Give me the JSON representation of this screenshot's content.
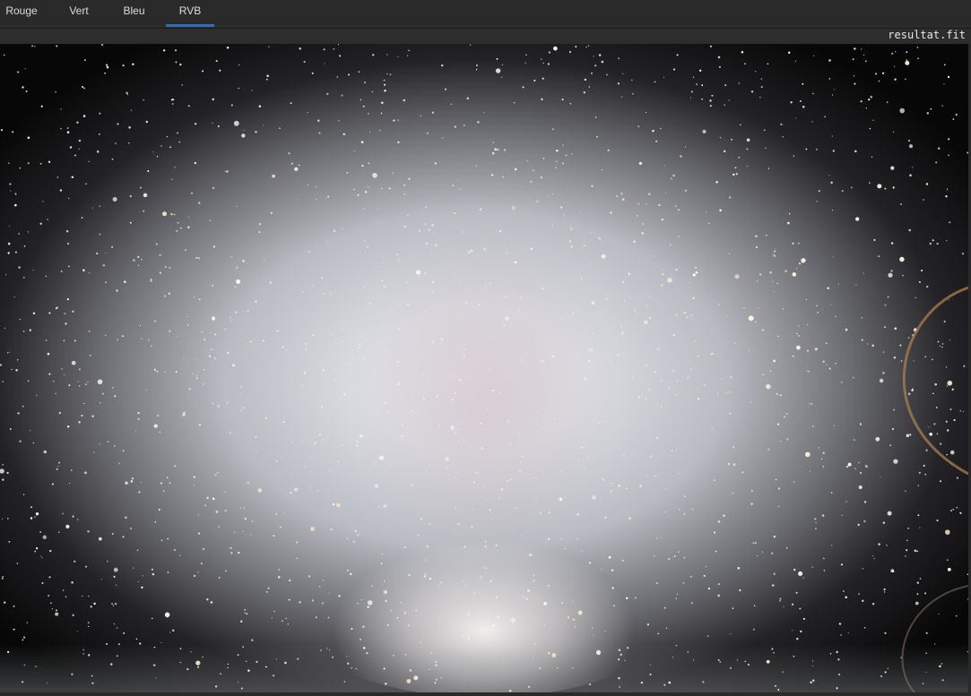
{
  "tabs": [
    {
      "label": "Rouge",
      "active": false
    },
    {
      "label": "Vert",
      "active": false
    },
    {
      "label": "Bleu",
      "active": false
    },
    {
      "label": "RVB",
      "active": true
    }
  ],
  "file": {
    "name": "resultat.fit"
  },
  "colors": {
    "accent": "#2f6fbe",
    "background": "#262626",
    "tab_text": "#dcdcdc"
  }
}
